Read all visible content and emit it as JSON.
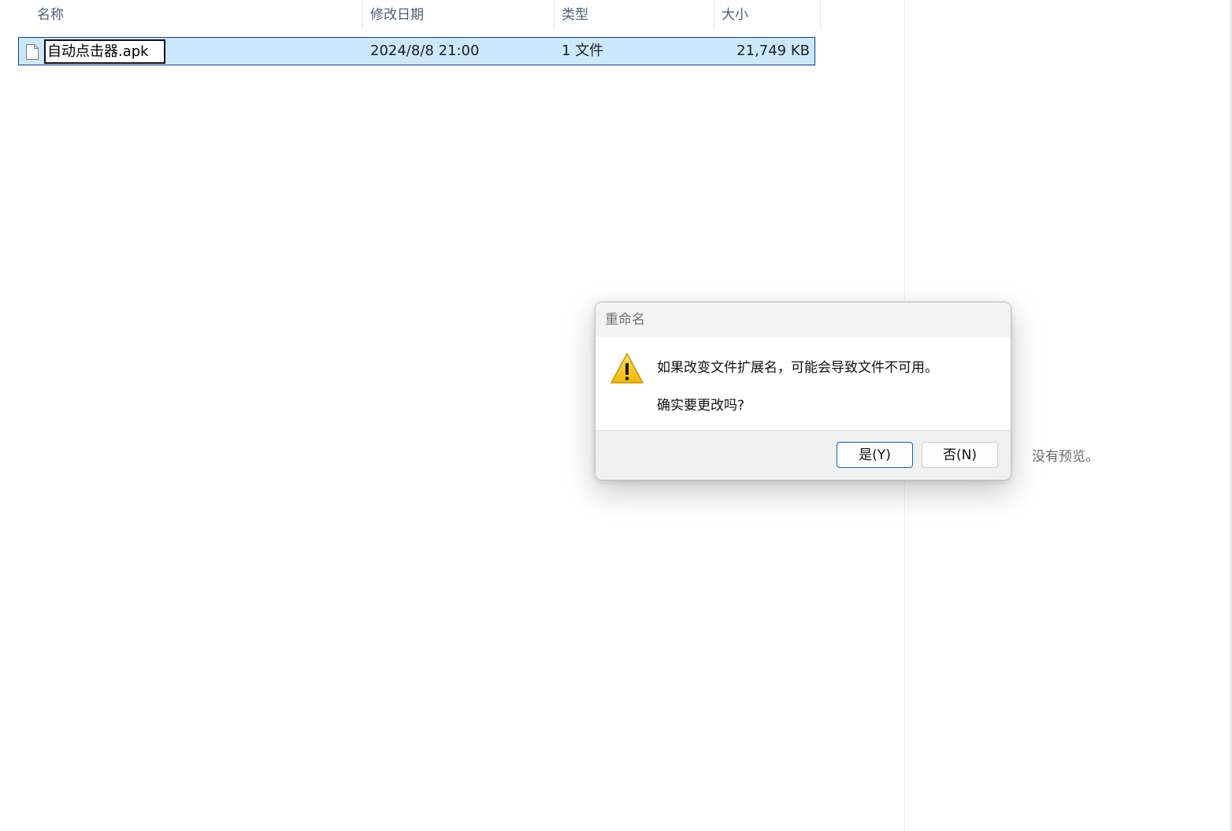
{
  "columns": {
    "name": "名称",
    "modified": "修改日期",
    "type": "类型",
    "size": "大小"
  },
  "sort_indicator": "^",
  "file": {
    "name_editing": "自动点击器.apk",
    "modified": "2024/8/8 21:00",
    "type": "1 文件",
    "size": "21,749 KB",
    "icon": "blank-file-icon"
  },
  "preview_pane": {
    "message": "没有预览。"
  },
  "dialog": {
    "title": "重命名",
    "icon": "warning-icon",
    "message_line1": "如果改变文件扩展名，可能会导致文件不可用。",
    "message_line2": "确实要更改吗?",
    "yes_label": "是(Y)",
    "no_label": "否(N)"
  },
  "colors": {
    "selection_bg": "#cce8ff",
    "selection_border": "#0b3d91",
    "header_text": "#4c607a",
    "accent": "#0067c0",
    "warning_yellow": "#f7c51b"
  }
}
